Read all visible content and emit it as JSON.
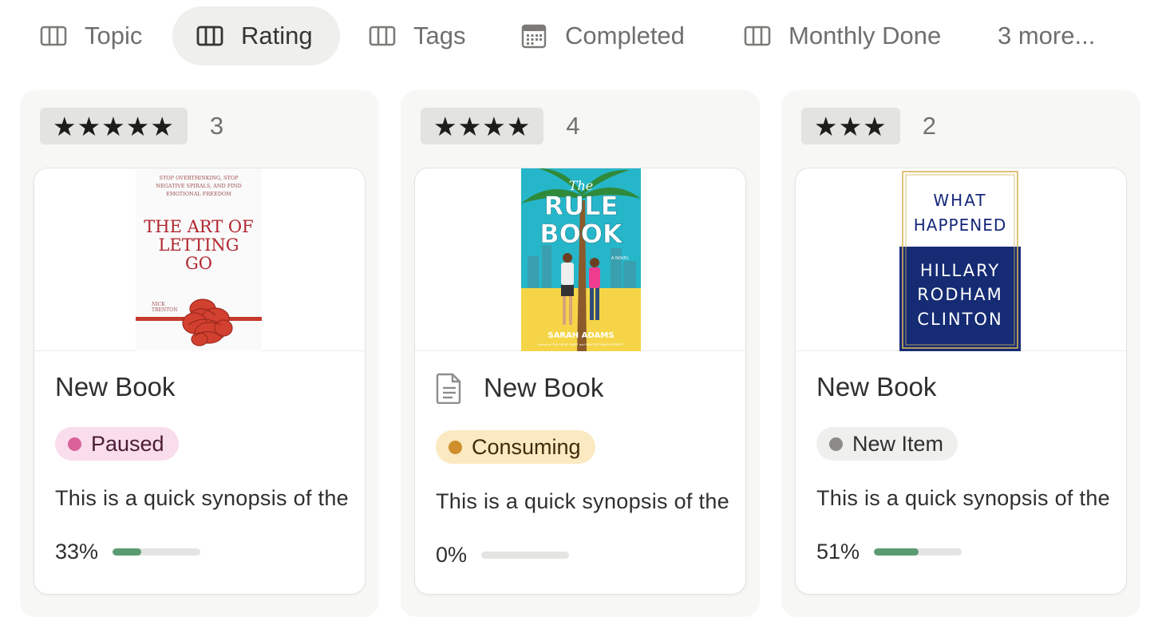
{
  "tabs": [
    {
      "label": "Topic",
      "icon": "table-columns-icon",
      "active": false
    },
    {
      "label": "Rating",
      "icon": "table-columns-icon",
      "active": true
    },
    {
      "label": "Tags",
      "icon": "table-columns-icon",
      "active": false
    },
    {
      "label": "Completed",
      "icon": "calendar-icon",
      "active": false
    },
    {
      "label": "Monthly Done",
      "icon": "table-columns-icon",
      "active": false
    }
  ],
  "more_label": "3 more...",
  "columns": [
    {
      "stars": "★★★★★",
      "count": "3",
      "card": {
        "cover_lines": [
          "STOP OVERTHINKING, STOP",
          "NEGATIVE SPIRALS, AND FIND",
          "EMOTIONAL FREEDOM",
          "THE ART OF",
          "LETTING",
          "GO",
          "NICK",
          "TRENTON"
        ],
        "title": "New Book",
        "has_doc_icon": false,
        "status": {
          "label": "Paused",
          "bg": "#f9dded",
          "dot": "#d9629a",
          "text": "#4b1c34"
        },
        "synopsis": "This is a quick synopsis of the",
        "progress_label": "33%",
        "progress": 0.33
      }
    },
    {
      "stars": "★★★★",
      "count": "4",
      "card": {
        "cover_lines": [
          "The",
          "RULE",
          "BOOK",
          "A NOVEL",
          "SARAH ADAMS",
          "Author of THE CHEAT SHEET and PRACTICE MAKES PERFECT"
        ],
        "title": "New Book",
        "has_doc_icon": true,
        "status": {
          "label": "Consuming",
          "bg": "#fbe9c1",
          "dot": "#cf8f2c",
          "text": "#3e2b0c"
        },
        "synopsis": "This is a quick synopsis of the",
        "progress_label": "0%",
        "progress": 0.0
      }
    },
    {
      "stars": "★★★",
      "count": "2",
      "card": {
        "cover_lines": [
          "WHAT",
          "HAPPENED",
          "HILLARY",
          "RODHAM",
          "CLINTON"
        ],
        "title": "New Book",
        "has_doc_icon": false,
        "status": {
          "label": "New Item",
          "bg": "#efefed",
          "dot": "#8c8b88",
          "text": "#2f2f2f"
        },
        "synopsis": "This is a quick synopsis of the",
        "progress_label": "51%",
        "progress": 0.51
      }
    }
  ],
  "colors": {
    "accent_progress": "#5c9b72",
    "column_bg": "#f7f7f5",
    "active_tab_bg": "#efefed"
  }
}
